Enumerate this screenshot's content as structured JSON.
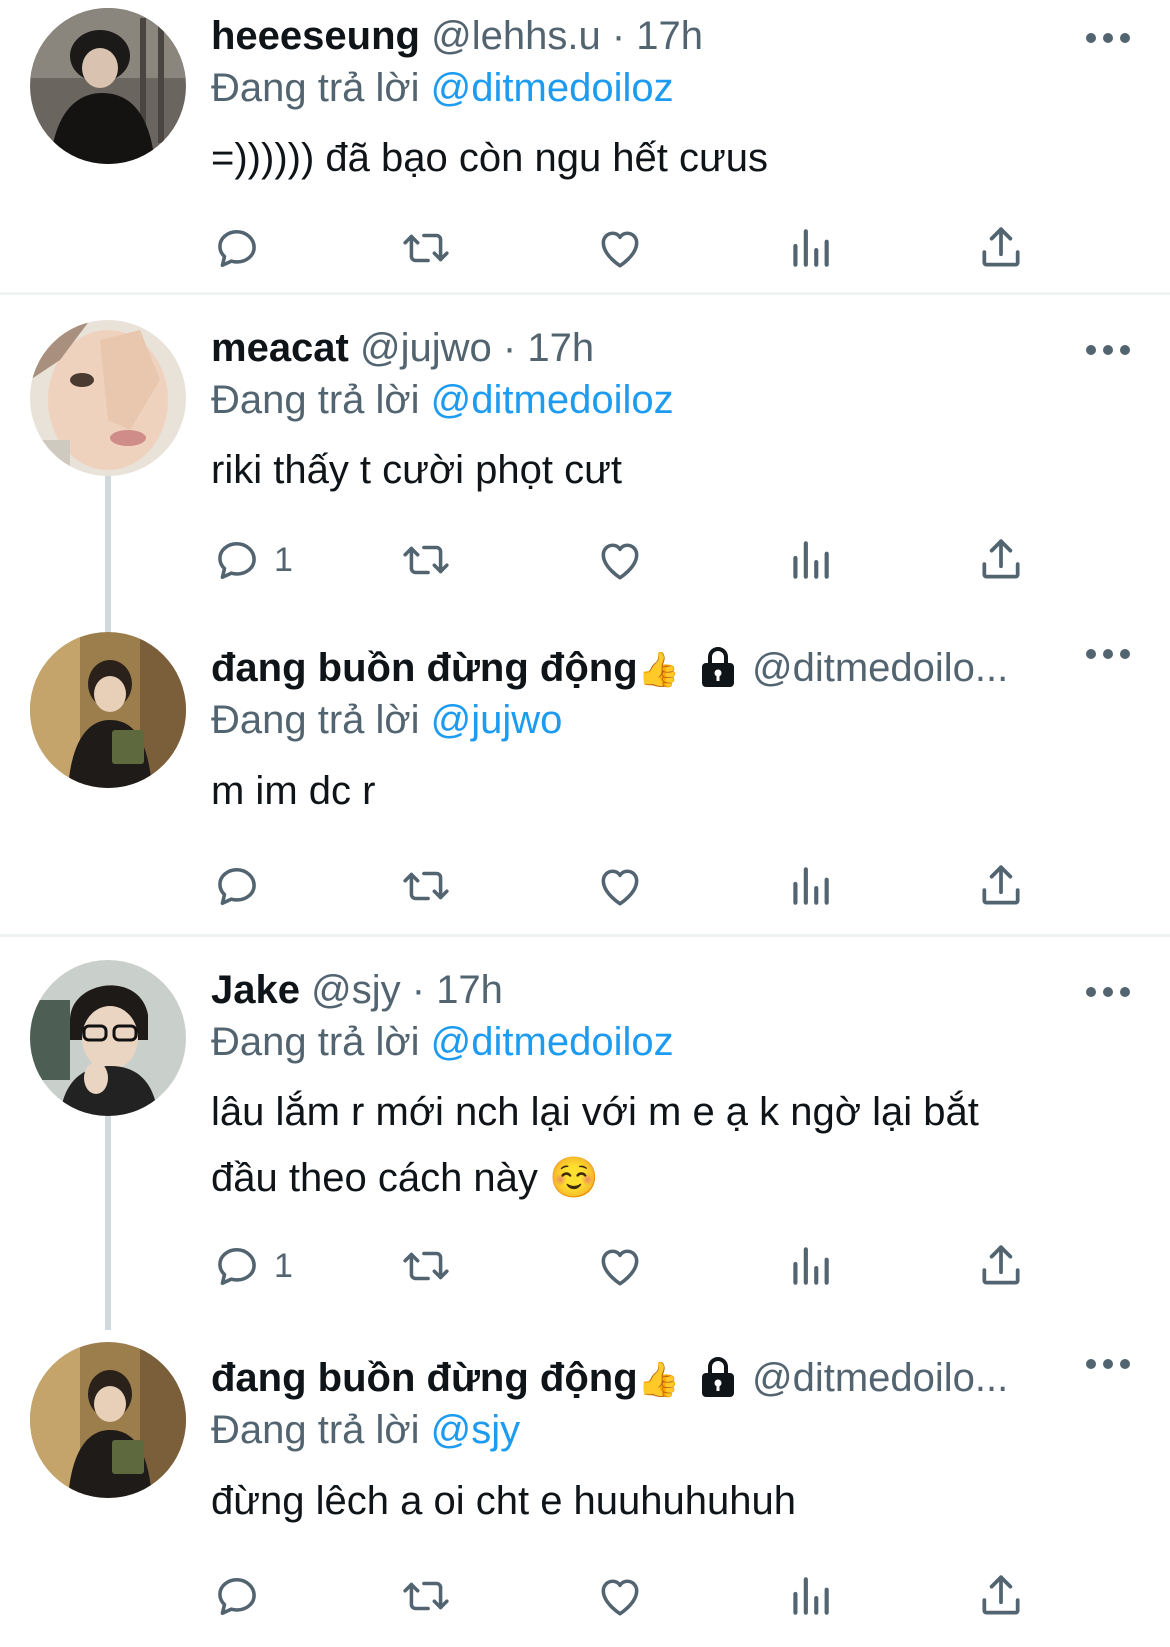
{
  "tweets": [
    {
      "name": "heeeseung",
      "handle": "@lehhs.u",
      "dot": "·",
      "time": "17h",
      "reply_prefix": "Đang trả lời",
      "reply_to": "@ditmedoiloz",
      "text": "=)))))) đã bạo còn ngu hết cưus",
      "reply_count": ""
    },
    {
      "name": "meacat",
      "handle": "@jujwo",
      "dot": "·",
      "time": "17h",
      "reply_prefix": "Đang trả lời",
      "reply_to": "@ditmedoiloz",
      "text": "riki thấy t cười phọt cưt",
      "reply_count": "1"
    },
    {
      "name": "đang buồn đừng động",
      "emoji": "👍",
      "handle": "@ditmedoilo...",
      "reply_prefix": "Đang trả lời",
      "reply_to": "@jujwo",
      "text": "m im dc r",
      "reply_count": ""
    },
    {
      "name": "Jake",
      "handle": "@sjy",
      "dot": "·",
      "time": "17h",
      "reply_prefix": "Đang trả lời",
      "reply_to": "@ditmedoiloz",
      "text_line1": "lâu lắm r mới nch lại với m e ạ k ngờ lại bắt",
      "text_line2": "đầu theo cách này",
      "text_emoji": "☺️",
      "reply_count": "1"
    },
    {
      "name": "đang buồn đừng động",
      "emoji": "👍",
      "handle": "@ditmedoilo...",
      "reply_prefix": "Đang trả lời",
      "reply_to": "@sjy",
      "text": "đừng lêch a oi cht e huuhuhuhuh",
      "reply_count": ""
    }
  ],
  "icons": [
    "reply-icon",
    "retweet-icon",
    "like-icon",
    "views-icon",
    "share-icon",
    "more-icon",
    "lock-icon"
  ],
  "colors": {
    "text": "#0f1419",
    "secondary": "#536471",
    "accent": "#1d9bf0",
    "divider": "#eff3f4",
    "thread_line": "#cfd9de"
  }
}
